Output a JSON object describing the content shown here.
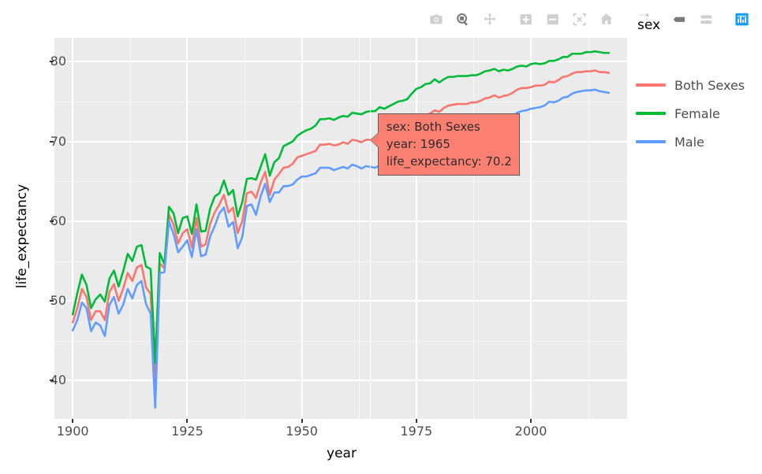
{
  "modebar": {
    "buttons": [
      {
        "name": "download-plot-icon",
        "title": "Download plot as a png",
        "state": "idle"
      },
      {
        "name": "zoom-icon",
        "title": "Zoom",
        "state": "active"
      },
      {
        "name": "pan-icon",
        "title": "Pan",
        "state": "idle"
      },
      {
        "name": "zoom-in-icon",
        "title": "Zoom in",
        "state": "idle"
      },
      {
        "name": "zoom-out-icon",
        "title": "Zoom out",
        "state": "idle"
      },
      {
        "name": "autoscale-icon",
        "title": "Autoscale",
        "state": "idle"
      },
      {
        "name": "reset-axes-icon",
        "title": "Reset axes",
        "state": "idle"
      },
      {
        "name": "toggle-spike-lines-icon",
        "title": "Toggle Spike Lines",
        "state": "idle"
      },
      {
        "name": "hover-closest-icon",
        "title": "Show closest data on hover",
        "state": "active"
      },
      {
        "name": "hover-compare-icon",
        "title": "Compare data on hover",
        "state": "idle"
      },
      {
        "name": "plotly-logo-icon",
        "title": "Produced with Plotly",
        "state": "brand"
      }
    ]
  },
  "legend": {
    "title": "sex",
    "items": [
      {
        "label": "Both Sexes",
        "color": "#F8766D"
      },
      {
        "label": "Female",
        "color": "#00BA38"
      },
      {
        "label": "Male",
        "color": "#619CFF"
      }
    ]
  },
  "tooltip": {
    "line1": "sex: Both Sexes",
    "line2": "year: 1965",
    "line3": "life_expectancy: 70.2",
    "bg_color": "#FB8072",
    "border_color": "#5A5A5A"
  },
  "chart_data": {
    "type": "line",
    "title": "",
    "xlabel": "year",
    "ylabel": "life_expectancy",
    "xlim": [
      1896,
      2021
    ],
    "ylim": [
      35.2,
      83.0
    ],
    "xticks": [
      1900,
      1925,
      1950,
      1975,
      2000
    ],
    "xticks_minor": [
      1912.5,
      1937.5,
      1962.5,
      1987.5,
      2012.5
    ],
    "yticks": [
      40,
      50,
      60,
      70,
      80
    ],
    "yticks_minor": [
      35,
      45,
      55,
      65,
      75
    ],
    "grid": true,
    "panel_bg": "#EBEBEB",
    "grid_color": "#FFFFFF",
    "legend_position": "right",
    "x": [
      1900,
      1901,
      1902,
      1903,
      1904,
      1905,
      1906,
      1907,
      1908,
      1909,
      1910,
      1911,
      1912,
      1913,
      1914,
      1915,
      1916,
      1917,
      1918,
      1919,
      1920,
      1921,
      1922,
      1923,
      1924,
      1925,
      1926,
      1927,
      1928,
      1929,
      1930,
      1931,
      1932,
      1933,
      1934,
      1935,
      1936,
      1937,
      1938,
      1939,
      1940,
      1941,
      1942,
      1943,
      1944,
      1945,
      1946,
      1947,
      1948,
      1949,
      1950,
      1951,
      1952,
      1953,
      1954,
      1955,
      1956,
      1957,
      1958,
      1959,
      1960,
      1961,
      1962,
      1963,
      1964,
      1965,
      1966,
      1967,
      1968,
      1969,
      1970,
      1971,
      1972,
      1973,
      1974,
      1975,
      1976,
      1977,
      1978,
      1979,
      1980,
      1981,
      1982,
      1983,
      1984,
      1985,
      1986,
      1987,
      1988,
      1989,
      1990,
      1991,
      1992,
      1993,
      1994,
      1995,
      1996,
      1997,
      1998,
      1999,
      2000,
      2001,
      2002,
      2003,
      2004,
      2005,
      2006,
      2007,
      2008,
      2009,
      2010,
      2011,
      2012,
      2013,
      2014,
      2015,
      2016,
      2017
    ],
    "series": [
      {
        "name": "Both Sexes",
        "color": "#F8766D",
        "values": [
          47.3,
          49.1,
          51.5,
          50.5,
          47.6,
          48.7,
          48.7,
          47.6,
          51.1,
          52.1,
          50.0,
          51.5,
          53.5,
          52.5,
          54.2,
          54.5,
          51.7,
          50.9,
          39.1,
          54.7,
          54.1,
          60.8,
          59.6,
          57.2,
          58.5,
          59.0,
          56.7,
          60.4,
          56.8,
          57.1,
          59.7,
          61.1,
          62.1,
          63.3,
          61.1,
          61.7,
          58.5,
          60.0,
          63.5,
          63.7,
          62.9,
          64.8,
          66.2,
          63.3,
          65.2,
          65.9,
          66.7,
          66.8,
          67.2,
          68.0,
          68.2,
          68.4,
          68.6,
          68.8,
          69.6,
          69.6,
          69.7,
          69.5,
          69.6,
          69.9,
          69.7,
          70.2,
          70.1,
          69.9,
          70.2,
          70.2,
          70.2,
          70.5,
          70.2,
          70.5,
          70.8,
          71.1,
          71.2,
          71.4,
          72.0,
          72.6,
          72.9,
          73.3,
          73.5,
          73.9,
          73.7,
          74.2,
          74.5,
          74.6,
          74.7,
          74.7,
          74.7,
          74.9,
          74.9,
          75.1,
          75.4,
          75.5,
          75.8,
          75.5,
          75.7,
          75.8,
          76.1,
          76.5,
          76.7,
          76.7,
          76.8,
          77.0,
          77.0,
          77.1,
          77.5,
          77.4,
          77.7,
          78.1,
          78.2,
          78.5,
          78.7,
          78.7,
          78.8,
          78.8,
          78.9,
          78.7,
          78.7,
          78.6
        ]
      },
      {
        "name": "Female",
        "color": "#00BA38",
        "values": [
          48.3,
          51.0,
          53.3,
          52.0,
          49.1,
          50.2,
          50.8,
          49.9,
          52.8,
          53.8,
          51.8,
          53.7,
          55.9,
          55.0,
          56.8,
          57.0,
          54.3,
          54.0,
          42.2,
          56.0,
          54.6,
          61.8,
          61.0,
          58.5,
          60.4,
          60.6,
          58.4,
          62.1,
          58.7,
          58.8,
          61.6,
          63.1,
          63.5,
          65.1,
          63.3,
          63.9,
          60.6,
          62.4,
          65.3,
          65.4,
          65.2,
          66.8,
          68.4,
          65.7,
          67.4,
          67.9,
          69.4,
          69.7,
          70.0,
          70.7,
          71.1,
          71.4,
          71.6,
          72.0,
          72.8,
          72.8,
          72.9,
          72.7,
          73.0,
          73.2,
          73.1,
          73.6,
          73.5,
          73.4,
          73.7,
          73.8,
          73.8,
          74.3,
          74.1,
          74.4,
          74.7,
          75.0,
          75.1,
          75.3,
          76.0,
          76.6,
          76.8,
          77.2,
          77.3,
          77.8,
          77.4,
          77.8,
          78.1,
          78.1,
          78.2,
          78.2,
          78.2,
          78.3,
          78.3,
          78.5,
          78.8,
          78.9,
          79.1,
          78.8,
          79.0,
          78.9,
          79.1,
          79.4,
          79.5,
          79.4,
          79.7,
          79.8,
          79.7,
          79.8,
          80.1,
          80.1,
          80.3,
          80.6,
          80.6,
          81.0,
          81.0,
          81.0,
          81.2,
          81.2,
          81.3,
          81.2,
          81.1,
          81.1
        ]
      },
      {
        "name": "Male",
        "color": "#619CFF",
        "values": [
          46.3,
          47.6,
          49.8,
          49.1,
          46.2,
          47.3,
          46.9,
          45.6,
          49.5,
          50.5,
          48.4,
          49.5,
          51.5,
          50.3,
          52.0,
          52.5,
          49.6,
          48.4,
          36.6,
          53.5,
          53.6,
          60.0,
          58.4,
          56.1,
          56.8,
          57.6,
          55.5,
          59.0,
          55.6,
          55.8,
          58.1,
          59.4,
          61.0,
          61.7,
          59.3,
          59.9,
          56.6,
          58.0,
          61.9,
          62.1,
          60.8,
          63.1,
          64.7,
          62.4,
          63.6,
          63.6,
          64.4,
          64.4,
          64.6,
          65.2,
          65.6,
          65.6,
          65.8,
          66.0,
          66.7,
          66.7,
          66.7,
          66.4,
          66.6,
          66.8,
          66.6,
          67.1,
          66.9,
          66.6,
          66.9,
          66.8,
          66.7,
          67.0,
          66.6,
          66.8,
          67.1,
          67.4,
          67.4,
          67.6,
          68.2,
          68.8,
          69.1,
          69.5,
          69.6,
          70.0,
          70.0,
          70.4,
          70.8,
          71.0,
          71.1,
          71.1,
          71.2,
          71.4,
          71.4,
          71.7,
          71.8,
          72.0,
          72.3,
          72.2,
          72.4,
          72.5,
          73.1,
          73.6,
          73.8,
          73.9,
          74.1,
          74.2,
          74.3,
          74.5,
          75.0,
          74.9,
          75.1,
          75.5,
          75.6,
          76.0,
          76.2,
          76.3,
          76.4,
          76.4,
          76.5,
          76.3,
          76.2,
          76.1
        ]
      }
    ],
    "annotation": {
      "x": 1965,
      "y": 70.2,
      "series": "Both Sexes"
    }
  }
}
